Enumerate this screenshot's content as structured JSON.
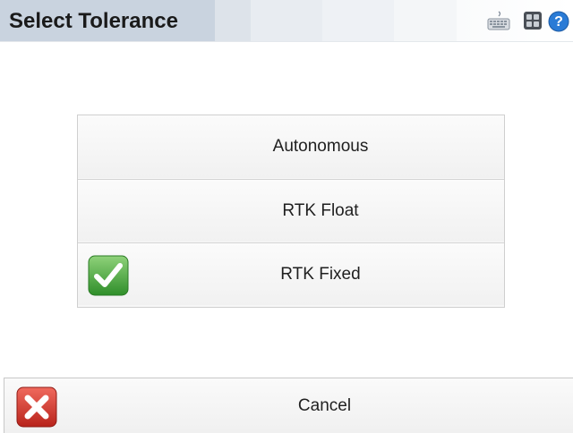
{
  "window": {
    "title": "Select Tolerance",
    "icons": [
      "keyboard-icon",
      "grid-icon",
      "help-icon"
    ]
  },
  "options": [
    {
      "label": "Autonomous",
      "selected": false
    },
    {
      "label": "RTK Float",
      "selected": false
    },
    {
      "label": "RTK Fixed",
      "selected": true
    }
  ],
  "footer": {
    "cancel_label": "Cancel",
    "icon": "cancel-x-icon"
  },
  "colors": {
    "check_green": "#3fa535",
    "cancel_red": "#d3322a",
    "help_blue": "#2a7bd6"
  }
}
